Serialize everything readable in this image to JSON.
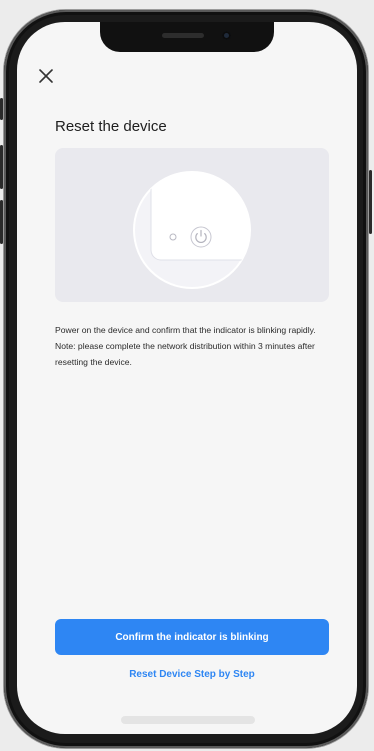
{
  "screen": {
    "title": "Reset the device",
    "close_icon": "close-icon",
    "illustration_icon": "power-icon",
    "instruction_line1": "Power on the device and confirm that the indicator is blinking rapidly.",
    "instruction_line2": "Note: please complete the network distribution within 3 minutes after resetting the device.",
    "primary_button": "Confirm the indicator is blinking",
    "secondary_link": "Reset Device Step by Step"
  },
  "colors": {
    "accent": "#2e86f3",
    "background": "#f6f6f6",
    "illustration_bg": "#e9e9ee",
    "text": "#1e1e1e"
  }
}
